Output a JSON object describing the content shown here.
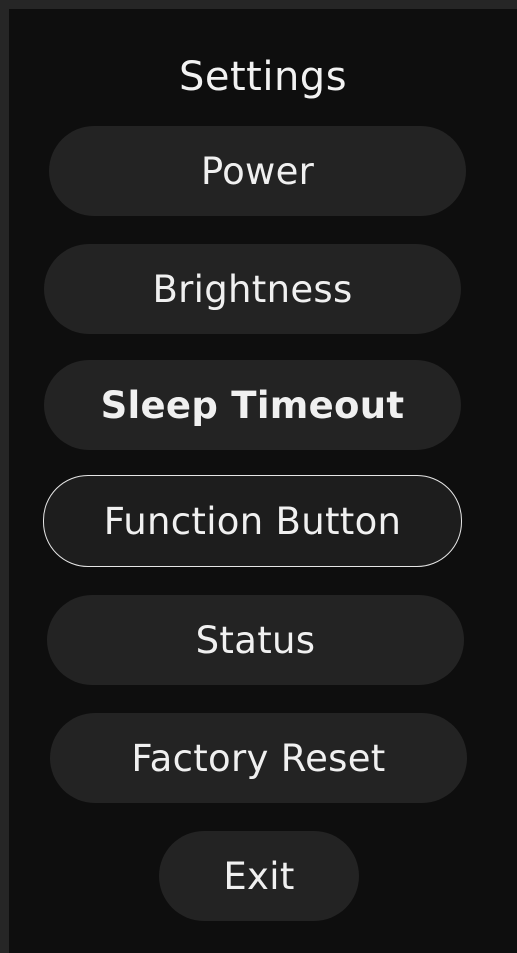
{
  "title": "Settings",
  "menu": {
    "power": "Power",
    "brightness": "Brightness",
    "sleep_timeout": "Sleep Timeout",
    "function_button": "Function Button",
    "status": "Status",
    "factory_reset": "Factory Reset",
    "exit": "Exit"
  },
  "selected_item": "function_button",
  "colors": {
    "background": "#0e0e0e",
    "button": "#232323",
    "text": "#f0f0f0",
    "selected_outline": "#e6e6e6"
  }
}
